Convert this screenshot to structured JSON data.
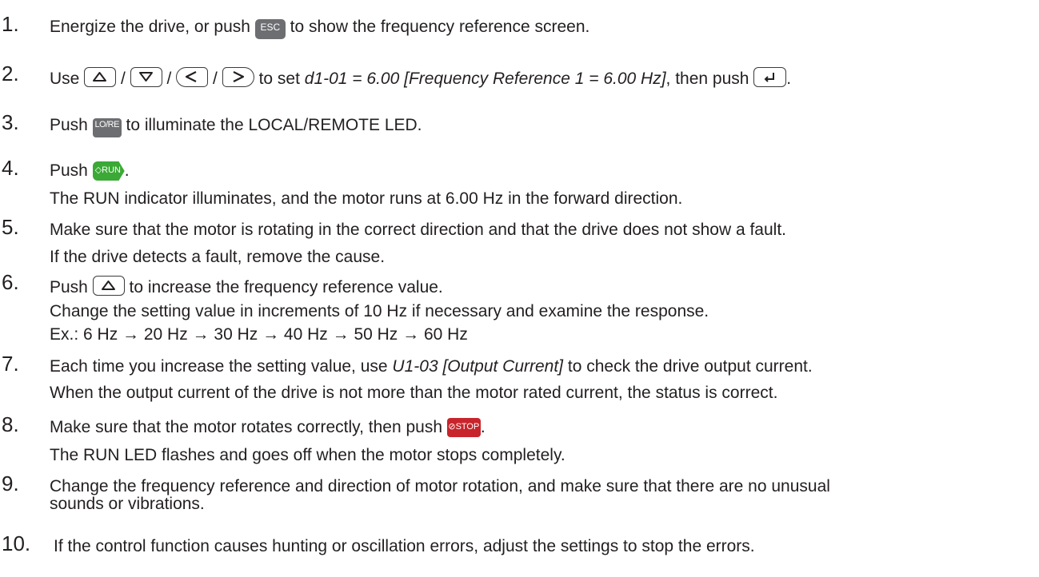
{
  "steps": [
    {
      "number": "1.",
      "text_before": "Energize the drive, or push ",
      "key": "ESC",
      "text_after": " to show the frequency reference screen."
    },
    {
      "number": "2.",
      "text_a": "Use ",
      "sep1": " / ",
      "sep2": " / ",
      "sep3": " / ",
      "text_b": " to set ",
      "param": "d1-01 = 6.00 [Frequency Reference 1 = 6.00 Hz]",
      "text_c": ", then push ",
      "text_d": "."
    },
    {
      "number": "3.",
      "text_before": "Push ",
      "key": "LO/RE",
      "text_after": " to illuminate the LOCAL/REMOTE LED."
    },
    {
      "number": "4.",
      "text_before": "Push ",
      "key": "RUN",
      "text_after": ".",
      "sub": "The RUN indicator illuminates, and the motor runs at 6.00 Hz in the forward direction."
    },
    {
      "number": "5.",
      "line1": "Make sure that the motor is rotating in the correct direction and that the drive does not show a fault.",
      "line2": "If the drive detects a fault, remove the cause."
    },
    {
      "number": "6.",
      "text_before": "Push ",
      "text_after": " to increase the frequency reference value.",
      "line2": "Change the setting value in increments of 10 Hz if necessary and examine the response.",
      "line3": "Ex.: 6 Hz → 20 Hz → 30 Hz → 40 Hz → 50 Hz → 60 Hz"
    },
    {
      "number": "7.",
      "text_before": "Each time you increase the setting value, use ",
      "param": "U1-03 [Output Current]",
      "text_after": " to check the drive output current.",
      "line2": "When the output current of the drive is not more than the motor rated current, the status is correct."
    },
    {
      "number": "8.",
      "text_before": "Make sure that the motor rotates correctly, then push ",
      "key": "STOP",
      "text_after": ".",
      "sub": "The RUN LED flashes and goes off when the motor stops completely."
    },
    {
      "number": "9.",
      "line1": "Change the frequency reference and direction of motor rotation, and make sure that there are no unusual",
      "line2": "sounds or vibrations."
    },
    {
      "number": "10.",
      "line1": "If the control function causes hunting or oscillation errors, adjust the settings to stop the errors."
    }
  ],
  "icons": {
    "up": "up-arrow-key-icon",
    "down": "down-arrow-key-icon",
    "left": "left-arrow-key-icon",
    "right": "right-arrow-key-icon",
    "enter": "enter-key-icon",
    "run_symbol": "◇",
    "stop_symbol": "⊘"
  },
  "colors": {
    "run_key": "#3aa935",
    "stop_key": "#c8242b",
    "gray_key": "#6d6e71"
  }
}
